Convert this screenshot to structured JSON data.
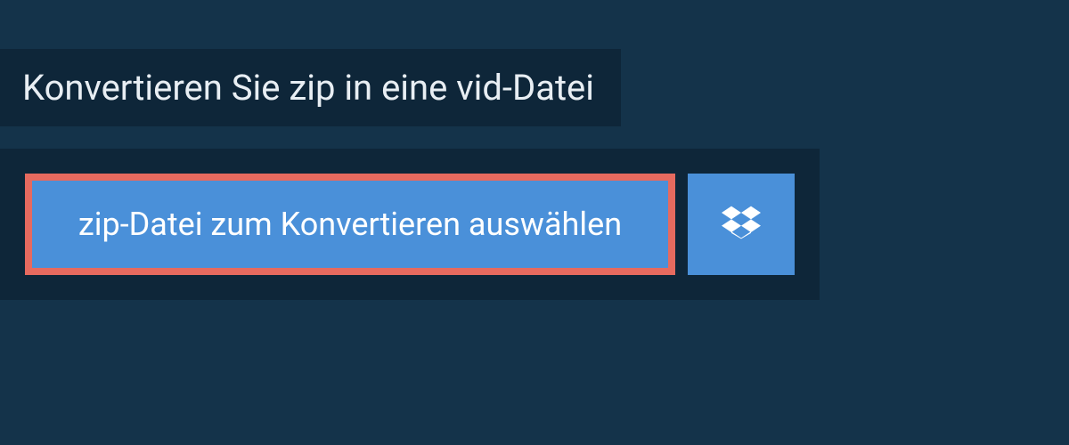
{
  "heading": "Konvertieren Sie zip in eine vid-Datei",
  "select_button_label": "zip-Datei zum Konvertieren auswählen",
  "colors": {
    "page_bg": "#14334a",
    "panel_bg": "#0e2639",
    "button_bg": "#4a90d9",
    "button_border": "#e66a5f",
    "text_light": "#e8eef3",
    "text_white": "#ffffff"
  }
}
